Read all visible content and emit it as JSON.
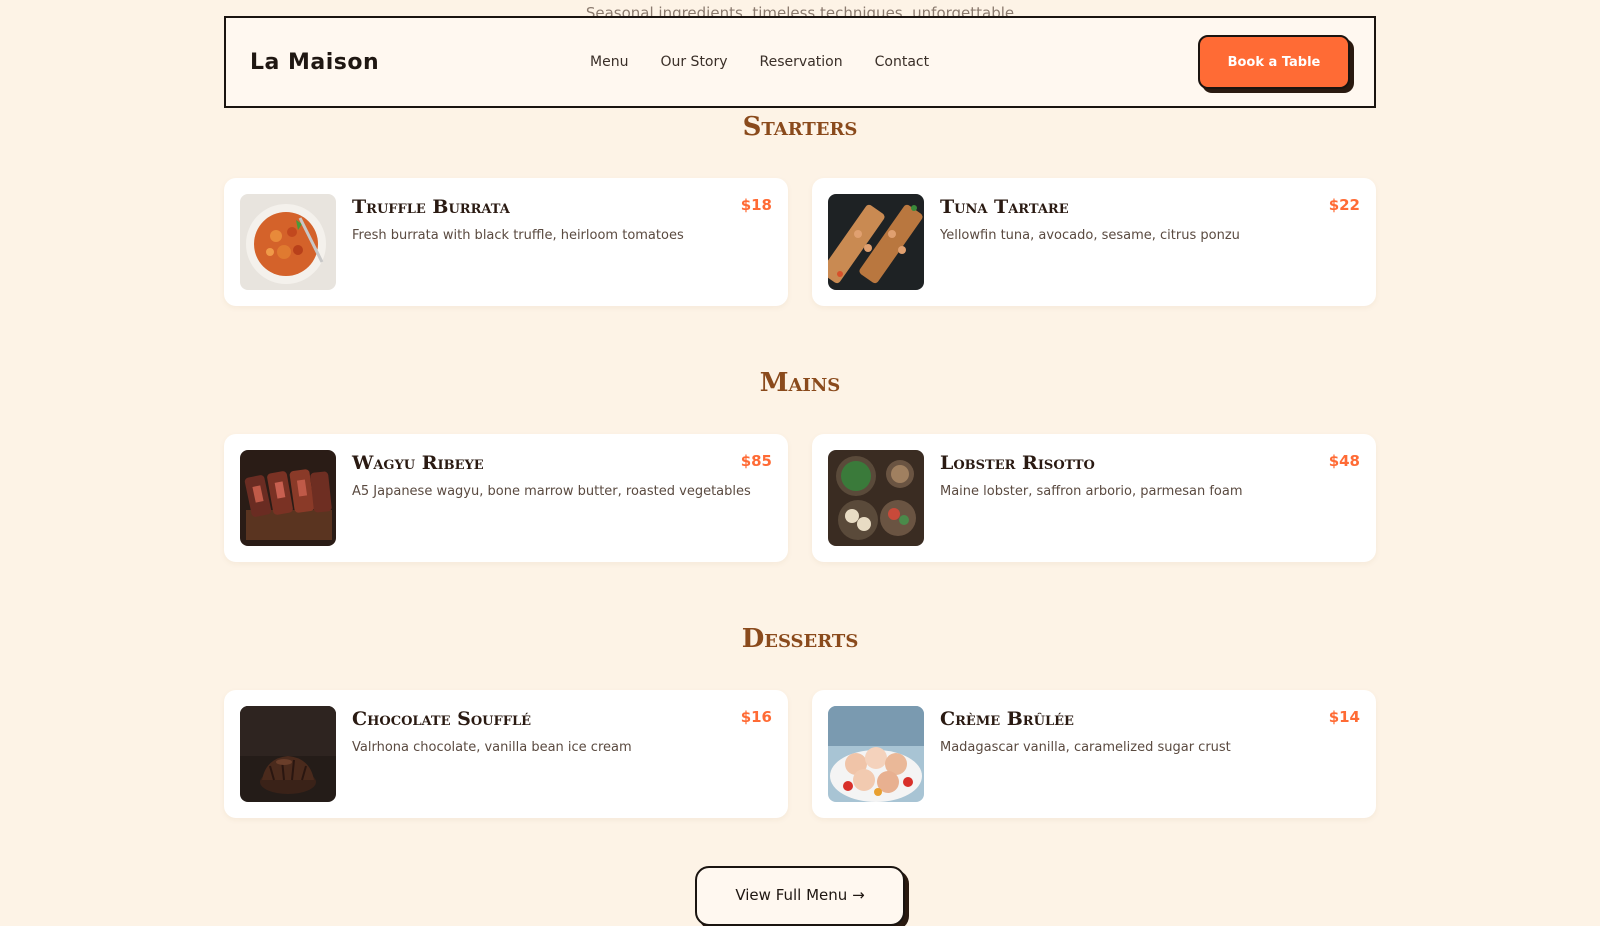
{
  "tagline": "Seasonal ingredients, timeless techniques, unforgettable",
  "header": {
    "brand": "La Maison",
    "nav": [
      "Menu",
      "Our Story",
      "Reservation",
      "Contact"
    ],
    "cta": "Book a Table"
  },
  "colors": {
    "accent": "#ff6b35",
    "heading": "#8a4a1c",
    "background": "#fdf3e6"
  },
  "sections": [
    {
      "title": "Starters",
      "items": [
        {
          "name": "Truffle Burrata",
          "desc": "Fresh burrata with black truffle, heirloom tomatoes",
          "price": "$18",
          "image": "pasta-photo"
        },
        {
          "name": "Tuna Tartare",
          "desc": "Yellowfin tuna, avocado, sesame, citrus ponzu",
          "price": "$22",
          "image": "tartare-board-photo"
        }
      ]
    },
    {
      "title": "Mains",
      "items": [
        {
          "name": "Wagyu Ribeye",
          "desc": "A5 Japanese wagyu, bone marrow butter, roasted vegetables",
          "price": "$85",
          "image": "steak-photo"
        },
        {
          "name": "Lobster Risotto",
          "desc": "Maine lobster, saffron arborio, parmesan foam",
          "price": "$48",
          "image": "dumplings-photo"
        }
      ]
    },
    {
      "title": "Desserts",
      "items": [
        {
          "name": "Chocolate Soufflé",
          "desc": "Valrhona chocolate, vanilla bean ice cream",
          "price": "$16",
          "image": "chocolate-cake-photo"
        },
        {
          "name": "Crème Brûlée",
          "desc": "Madagascar vanilla, caramelized sugar crust",
          "price": "$14",
          "image": "macarons-photo"
        }
      ]
    }
  ],
  "footer_cta": {
    "label": "View Full Menu",
    "arrow": "→"
  }
}
